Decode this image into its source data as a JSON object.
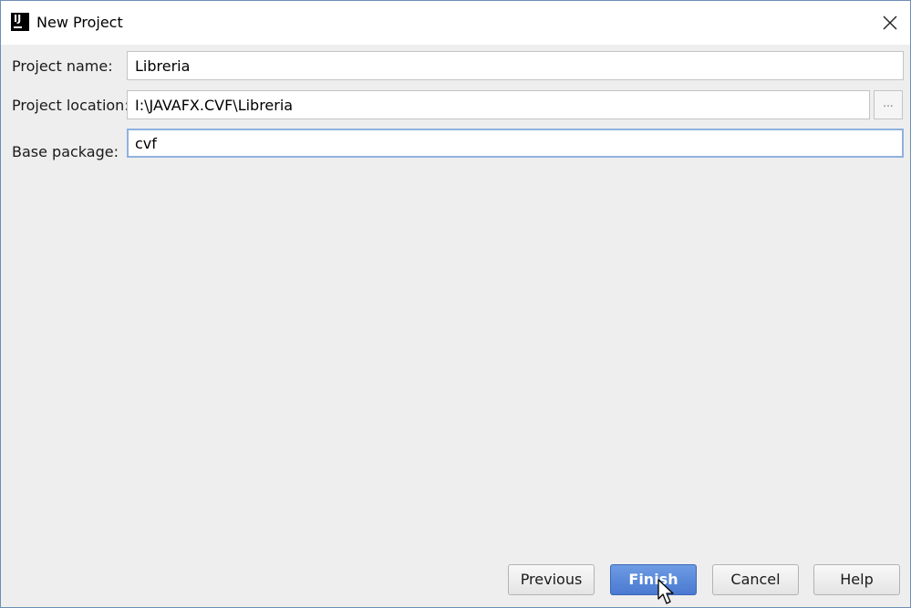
{
  "window": {
    "title": "New Project",
    "app_icon": "intellij-idea-icon",
    "close_icon": "close-icon"
  },
  "form": {
    "project_name": {
      "label": "Project name:",
      "value": "Libreria"
    },
    "project_location": {
      "label": "Project location:",
      "value": "I:\\JAVAFX.CVF\\Libreria",
      "browse_label": "..."
    },
    "base_package": {
      "label": "Base package:",
      "value": "cvf"
    }
  },
  "buttons": {
    "previous": "Previous",
    "finish": "Finish",
    "cancel": "Cancel",
    "help": "Help"
  },
  "colors": {
    "primary_button": "#4a79d1",
    "focus_border": "#8fb1de",
    "window_border": "#6d8fb5"
  }
}
